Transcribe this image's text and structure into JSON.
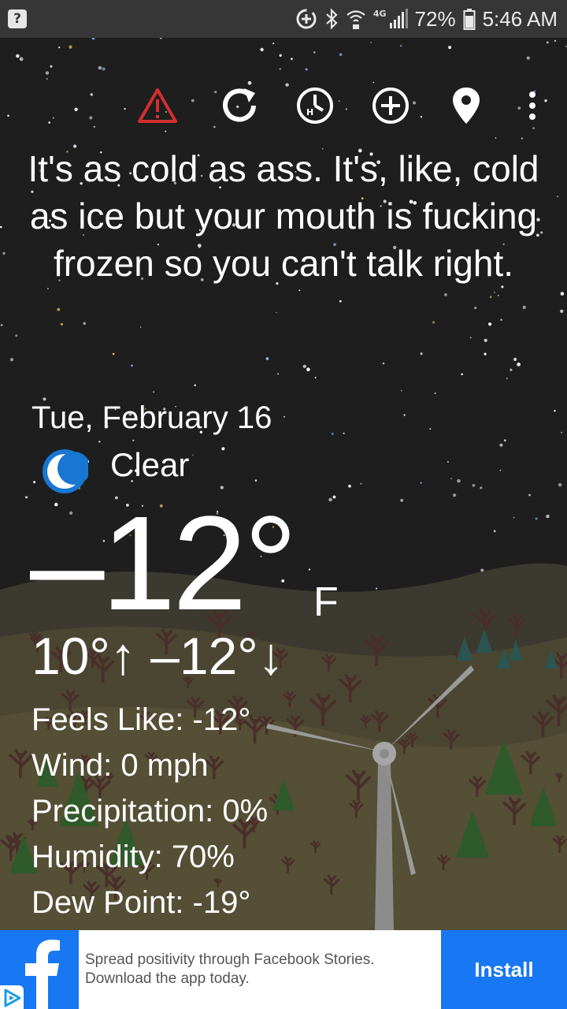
{
  "status_bar": {
    "battery": "72%",
    "time": "5:46 AM",
    "network": "4G",
    "icons": [
      "help-icon",
      "data-saver-icon",
      "bluetooth-icon",
      "wifi-calling-icon",
      "signal-icon",
      "battery-icon"
    ]
  },
  "toolbar": {
    "icons": [
      "alert-icon",
      "refresh-icon",
      "hourly-forecast-icon",
      "add-location-icon",
      "location-icon",
      "more-options-icon"
    ],
    "alert_color": "#d32f2f"
  },
  "quote": "It's as cold as ass. It's, like, cold as ice but your mouth is fucking frozen so you can't talk right.",
  "weather": {
    "date": "Tue, February 16",
    "condition": "Clear",
    "condition_icon": "moon-icon",
    "temperature": "–12°",
    "unit": "F",
    "high_low": "10°↑ –12°↓",
    "details": [
      "Feels Like: -12°",
      "Wind: 0 mph",
      "Precipitation: 0%",
      "Humidity: 70%",
      "Dew Point: -19°"
    ]
  },
  "ad": {
    "brand_icon": "facebook-icon",
    "line1": "Spread positivity through Facebook Stories.",
    "line2": "Download the app today.",
    "button": "Install",
    "accent": "#1877f2"
  }
}
